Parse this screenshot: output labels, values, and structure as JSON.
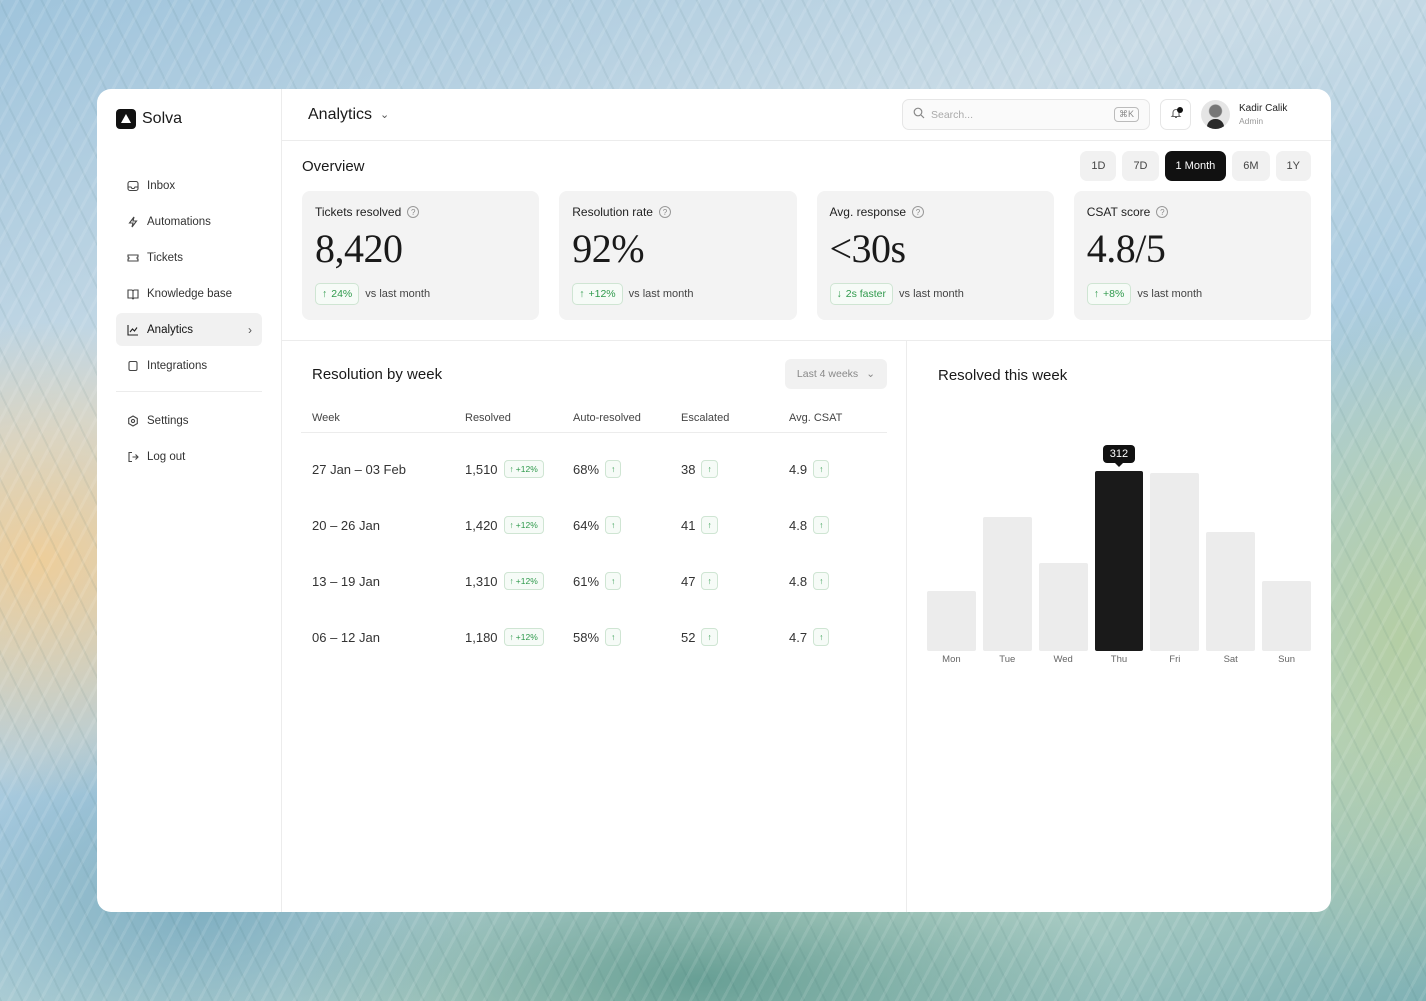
{
  "brand": {
    "name": "Solva"
  },
  "sidebar": {
    "items": [
      {
        "label": "Inbox",
        "icon": "inbox-icon"
      },
      {
        "label": "Automations",
        "icon": "bolt-icon"
      },
      {
        "label": "Tickets",
        "icon": "ticket-icon"
      },
      {
        "label": "Knowledge base",
        "icon": "book-icon"
      },
      {
        "label": "Analytics",
        "icon": "chart-line-icon",
        "active": true
      },
      {
        "label": "Integrations",
        "icon": "square-icon"
      }
    ],
    "footer": [
      {
        "label": "Settings",
        "icon": "gear-icon"
      },
      {
        "label": "Log out",
        "icon": "logout-icon"
      }
    ]
  },
  "header": {
    "title": "Analytics",
    "search_placeholder": "Search...",
    "search_shortcut": "⌘K",
    "user": {
      "name": "Kadir Calik",
      "role": "Admin"
    }
  },
  "overview": {
    "title": "Overview",
    "ranges": [
      "1D",
      "7D",
      "1 Month",
      "6M",
      "1Y"
    ],
    "active_range": "1 Month",
    "kpis": [
      {
        "label": "Tickets resolved",
        "value": "8,420",
        "delta": "24%",
        "delta_dir": "up",
        "compare": "vs last month"
      },
      {
        "label": "Resolution rate",
        "value": "92%",
        "delta": "+12%",
        "delta_dir": "up",
        "compare": "vs last month"
      },
      {
        "label": "Avg. response",
        "value": "<30s",
        "delta": "2s faster",
        "delta_dir": "down",
        "compare": "vs last month"
      },
      {
        "label": "CSAT score",
        "value": "4.8/5",
        "delta": "+8%",
        "delta_dir": "up",
        "compare": "vs last month"
      }
    ]
  },
  "resolution_table": {
    "title": "Resolution by week",
    "filter": "Last 4 weeks",
    "columns": [
      "Week",
      "Resolved",
      "Auto-resolved",
      "Escalated",
      "Avg. CSAT"
    ],
    "rows": [
      {
        "week": "27 Jan – 03 Feb",
        "resolved": "1,510",
        "resolved_delta": "+12%",
        "auto": "68%",
        "escalated": "38",
        "csat": "4.9"
      },
      {
        "week": "20 – 26 Jan",
        "resolved": "1,420",
        "resolved_delta": "+12%",
        "auto": "64%",
        "escalated": "41",
        "csat": "4.8"
      },
      {
        "week": "13 – 19 Jan",
        "resolved": "1,310",
        "resolved_delta": "+12%",
        "auto": "61%",
        "escalated": "47",
        "csat": "4.8"
      },
      {
        "week": "06 – 12 Jan",
        "resolved": "1,180",
        "resolved_delta": "+12%",
        "auto": "58%",
        "escalated": "52",
        "csat": "4.7"
      }
    ]
  },
  "chart_panel": {
    "title": "Resolved this week"
  },
  "chart_data": {
    "type": "bar",
    "title": "Resolved this week",
    "categories": [
      "Mon",
      "Tue",
      "Wed",
      "Thu",
      "Fri",
      "Sat",
      "Sun"
    ],
    "values": [
      105,
      232,
      153,
      312,
      310,
      206,
      121
    ],
    "highlight_index": 3,
    "highlight_label": "312",
    "ylim": [
      0,
      330
    ],
    "grid": false,
    "colors": {
      "bar": "#ececec",
      "highlight": "#1a1a1a"
    }
  },
  "colors": {
    "positive": "#2f9a4c",
    "accent": "#111111"
  }
}
